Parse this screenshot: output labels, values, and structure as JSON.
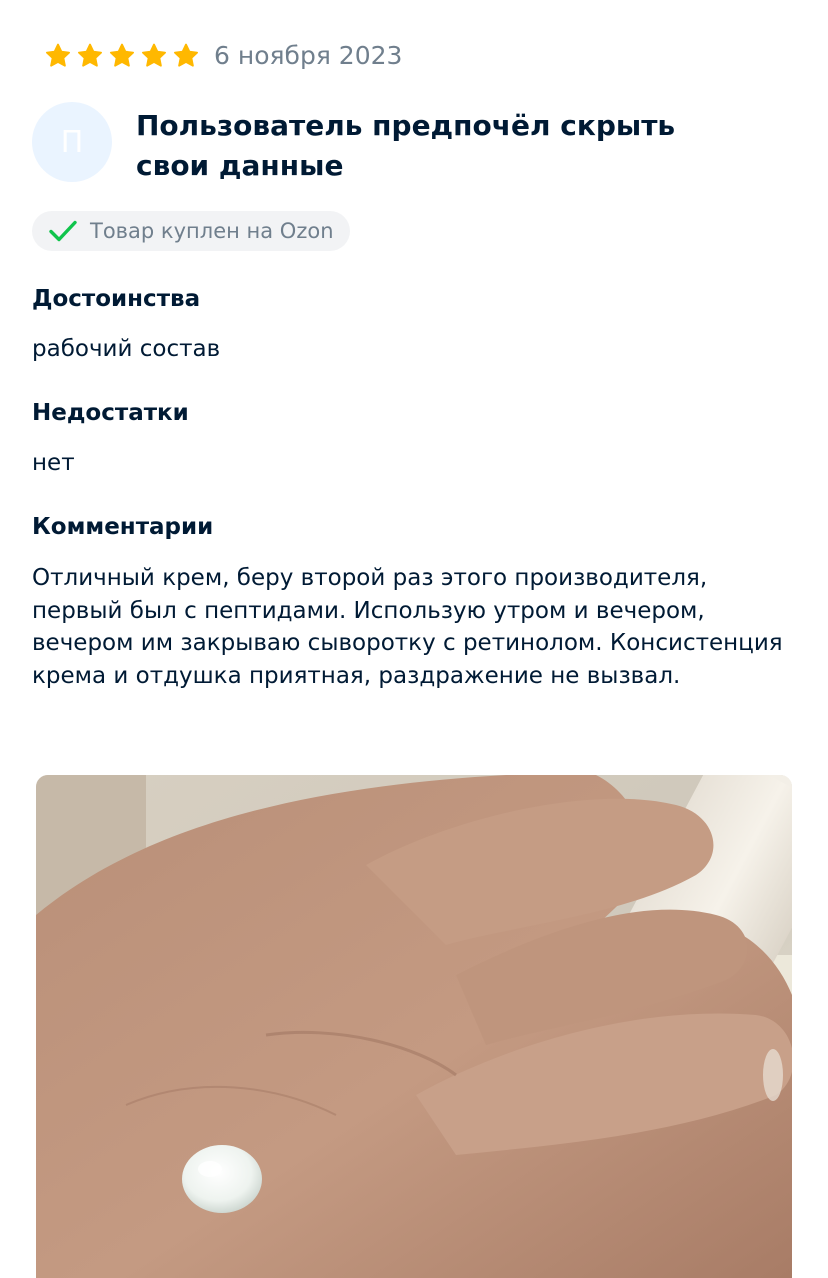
{
  "review": {
    "rating": 5,
    "rating_max": 5,
    "star_color": "#ffb800",
    "date": "6 ноября 2023",
    "author": {
      "avatar_letter": "П",
      "name": "Пользователь предпочёл скрыть свои данные"
    },
    "badge": {
      "icon": "check-icon",
      "text": "Товар куплен на Ozon",
      "icon_color": "#10c44c"
    },
    "pros": {
      "heading": "Достоинства",
      "text": "рабочий состав"
    },
    "cons": {
      "heading": "Недостатки",
      "text": "нет"
    },
    "comment": {
      "heading": "Комментарии",
      "text": "Отличный крем, беру второй раз этого производителя, первый был с пептидами. Использую утром и вечером, вечером им закрываю сыворотку с ретинолом. Консистенция крема и отдушка приятная, раздражение не вызвал."
    }
  }
}
